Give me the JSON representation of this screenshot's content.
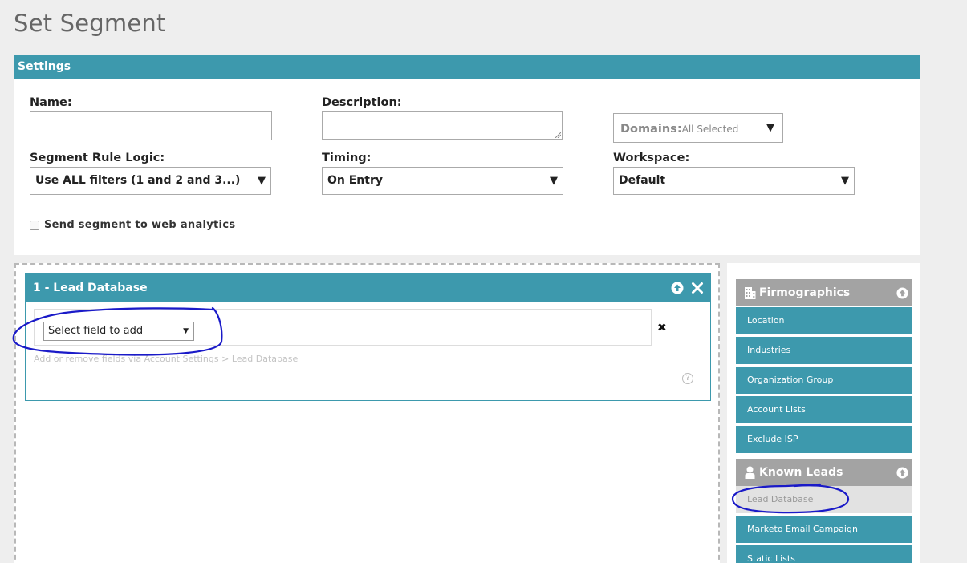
{
  "page": {
    "title": "Set Segment"
  },
  "settings": {
    "header": "Settings",
    "name_label": "Name:",
    "name_value": "",
    "description_label": "Description:",
    "description_value": "",
    "domains_label": "Domains:",
    "domains_value": "All Selected",
    "rule_logic_label": "Segment Rule Logic:",
    "rule_logic_value": "Use ALL filters (1 and 2 and 3...)",
    "timing_label": "Timing:",
    "timing_value": "On Entry",
    "workspace_label": "Workspace:",
    "workspace_value": "Default",
    "send_analytics_label": "Send segment to web analytics",
    "send_analytics_checked": false
  },
  "filter": {
    "title": "1 - Lead Database",
    "field_select_value": "Select field to add",
    "hint": "Add or remove fields via Account Settings > Lead Database",
    "help_glyph": "?"
  },
  "categories": [
    {
      "header": "Firmographics",
      "icon": "building-icon",
      "items": [
        "Location",
        "Industries",
        "Organization Group",
        "Account Lists",
        "Exclude ISP"
      ]
    },
    {
      "header": "Known Leads",
      "icon": "person-icon",
      "items": [
        "Lead Database",
        "Marketo Email Campaign",
        "Static Lists"
      ],
      "active_item": "Lead Database"
    }
  ],
  "colors": {
    "accent": "#3d99ad",
    "category_header": "#a3a3a3",
    "annotation": "#1a1ac8"
  },
  "icons": {
    "arrow_down": "▼",
    "close": "✖"
  }
}
